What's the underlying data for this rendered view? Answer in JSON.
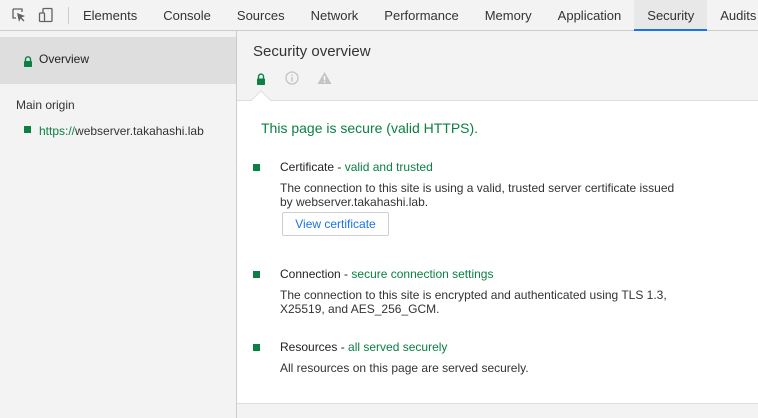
{
  "toolbar": {
    "icons": [
      "inspect-element-icon",
      "device-toolbar-icon"
    ],
    "tabs": [
      {
        "label": "Elements",
        "active": false
      },
      {
        "label": "Console",
        "active": false
      },
      {
        "label": "Sources",
        "active": false
      },
      {
        "label": "Network",
        "active": false
      },
      {
        "label": "Performance",
        "active": false
      },
      {
        "label": "Memory",
        "active": false
      },
      {
        "label": "Application",
        "active": false
      },
      {
        "label": "Security",
        "active": true
      },
      {
        "label": "Audits",
        "active": false
      }
    ]
  },
  "sidebar": {
    "overview_label": "Overview",
    "main_origin_heading": "Main origin",
    "origin": {
      "scheme": "https://",
      "host": "webserver.takahashi.lab"
    }
  },
  "main": {
    "title": "Security overview",
    "header_icons": [
      "lock-icon",
      "info-icon",
      "warning-icon"
    ],
    "summary": "This page is secure (valid HTTPS).",
    "sections": [
      {
        "name": "Certificate",
        "status": "valid and trusted",
        "description": "The connection to this site is using a valid, trusted server certificate issued by webserver.takahashi.lab.",
        "button_label": "View certificate"
      },
      {
        "name": "Connection",
        "status": "secure connection settings",
        "description": "The connection to this site is encrypted and authenticated using TLS 1.3, X25519, and AES_256_GCM."
      },
      {
        "name": "Resources",
        "status": "all served securely",
        "description": "All resources on this page are served securely."
      }
    ]
  },
  "colors": {
    "secure_green": "#0b8043",
    "accent_blue": "#1a73e8",
    "panel_gray": "#f3f3f3"
  }
}
